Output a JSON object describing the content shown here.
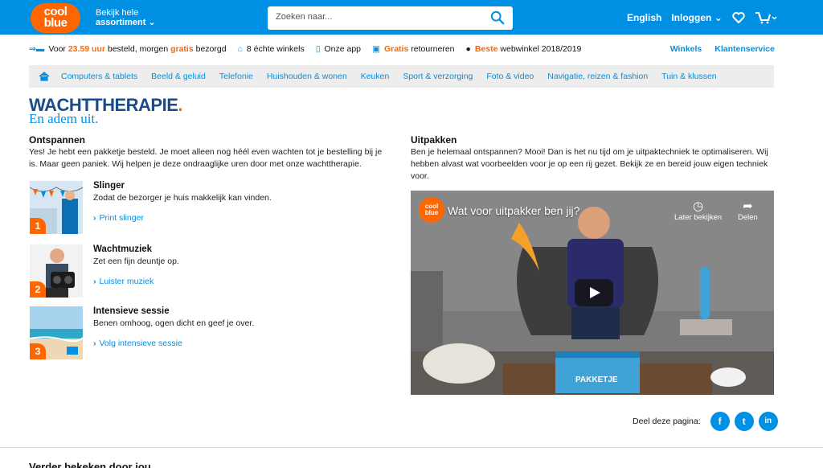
{
  "header": {
    "logo_line1": "cool",
    "logo_line2": "blue",
    "assort_line1": "Bekijk hele",
    "assort_line2": "assortiment",
    "search_placeholder": "Zoeken naar...",
    "language": "English",
    "login": "Inloggen"
  },
  "usp": {
    "delivery_pre": "Voor",
    "delivery_time": "23.59 uur",
    "delivery_mid": "besteld, morgen",
    "delivery_free": "gratis",
    "delivery_post": "bezorgd",
    "stores": "8 échte winkels",
    "app": "Onze app",
    "returns_free": "Gratis",
    "returns": "retourneren",
    "best_label": "Beste",
    "best_rest": "webwinkel 2018/2019",
    "link_stores": "Winkels",
    "link_service": "Klantenservice"
  },
  "catnav": [
    "Computers & tablets",
    "Beeld & geluid",
    "Telefonie",
    "Huishouden & wonen",
    "Keuken",
    "Sport & verzorging",
    "Foto & video",
    "Navigatie, reizen & fashion",
    "Tuin & klussen"
  ],
  "page": {
    "title": "WACHTTHERAPIE",
    "title_dot": ".",
    "subtitle": "En adem uit."
  },
  "left": {
    "heading": "Ontspannen",
    "intro": "Yes! Je hebt een pakketje besteld. Je moet alleen nog héél even wachten tot je bestelling bij je is. Maar geen paniek. Wij helpen je deze ondraaglijke uren door met onze wachttherapie.",
    "items": [
      {
        "num": "1",
        "title": "Slinger",
        "desc": "Zodat de bezorger je huis makkelijk kan vinden.",
        "link": "Print slinger"
      },
      {
        "num": "2",
        "title": "Wachtmuziek",
        "desc": "Zet een fijn deuntje op.",
        "link": "Luister muziek"
      },
      {
        "num": "3",
        "title": "Intensieve sessie",
        "desc": "Benen omhoog, ogen dicht en geef je over.",
        "link": "Volg intensieve sessie"
      }
    ]
  },
  "right": {
    "heading": "Uitpakken",
    "intro": "Ben je helemaal ontspannen? Mooi! Dan is het nu tijd om je uitpaktechniek te optimaliseren. Wij hebben alvast wat voorbeelden voor je op een rij gezet. Bekijk ze en bereid jouw eigen techniek voor.",
    "video_title": "Wat voor uitpakker ben jij?",
    "watch_later": "Later bekijken",
    "share": "Delen",
    "box_label": "PAKKETJE"
  },
  "share": {
    "label": "Deel deze pagina:",
    "facebook": "f",
    "twitter": "t",
    "linkedin": "in"
  },
  "bottom": {
    "heading": "Verder bekeken door jou"
  },
  "colors": {
    "brand_blue": "#0090e3",
    "brand_orange": "#ff6600",
    "title_navy": "#1a4a8a"
  }
}
